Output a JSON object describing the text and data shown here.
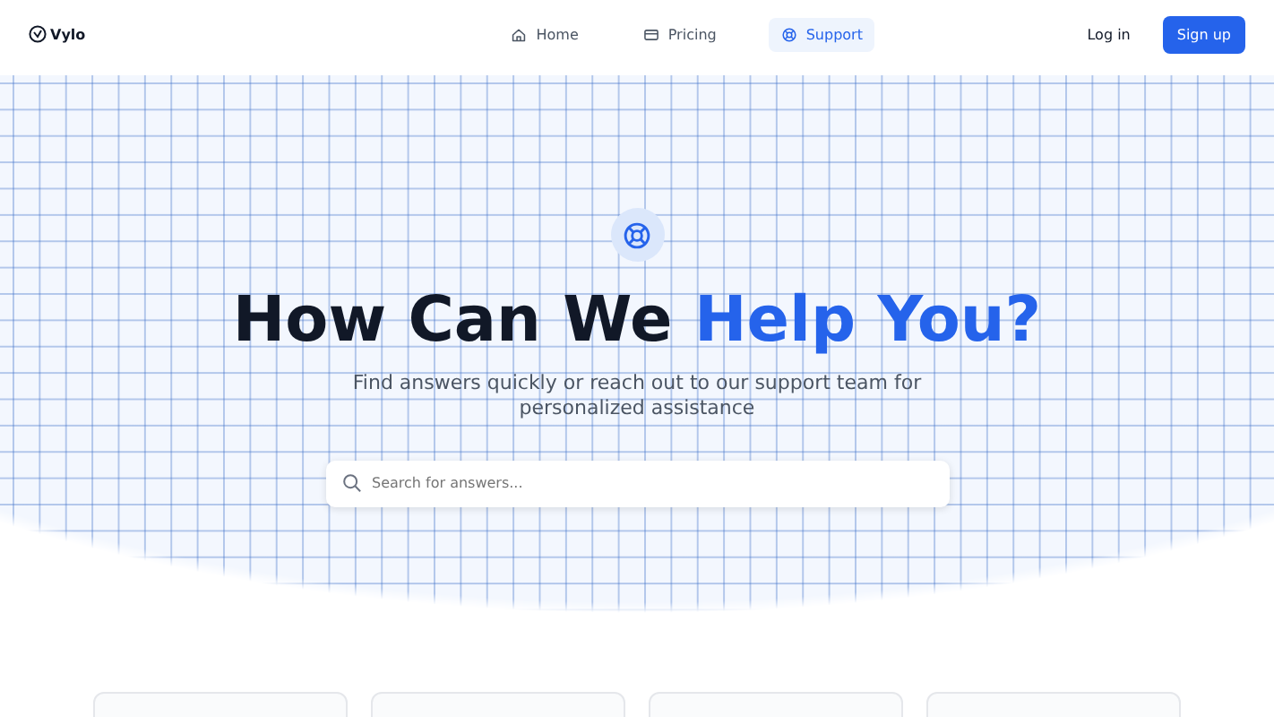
{
  "brand": {
    "name": "Vylo"
  },
  "nav": [
    {
      "label": "Home",
      "kind": "home",
      "selected": false
    },
    {
      "label": "Pricing",
      "kind": "pricing",
      "selected": false
    },
    {
      "label": "Support",
      "kind": "support",
      "selected": true
    }
  ],
  "auth": {
    "login": "Log in",
    "signup": "Sign up"
  },
  "hero": {
    "title": "How Can We",
    "title_highlight": "Help You?",
    "subtitle": "Find answers quickly or reach out to our support team for personalized assistance",
    "search": {
      "placeholder": "Search for answers..."
    }
  }
}
